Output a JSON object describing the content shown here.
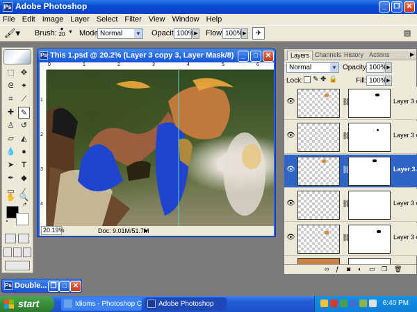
{
  "window": {
    "title": "Adobe Photoshop"
  },
  "menu": [
    "File",
    "Edit",
    "Image",
    "Layer",
    "Select",
    "Filter",
    "View",
    "Window",
    "Help"
  ],
  "options": {
    "brush_label": "Brush:",
    "brush_size": "20",
    "mode_label": "Mode:",
    "mode_value": "Normal",
    "opacity_label": "Opacity:",
    "opacity_value": "100%",
    "flow_label": "Flow:",
    "flow_value": "100%"
  },
  "document": {
    "title": "This 1.psd @ 20.2% (Layer 3 copy 3, Layer Mask/8)",
    "ruler_top": [
      "0",
      "1",
      "2",
      "3",
      "4",
      "5",
      "6"
    ],
    "ruler_left": [
      "1",
      "2",
      "3",
      "4"
    ],
    "zoom": "20.19%",
    "doc_info": "Doc: 9.01M/51.7M"
  },
  "layers_panel": {
    "tabs": [
      "Layers",
      "Channels",
      "History",
      "Actions"
    ],
    "blend_mode": "Normal",
    "opacity_label": "Opacity:",
    "opacity_value": "100%",
    "lock_label": "Lock:",
    "fill_label": "Fill:",
    "fill_value": "100%",
    "layers": [
      {
        "name": "Layer 3 c...",
        "selected": false
      },
      {
        "name": "Layer 3 c...",
        "selected": false
      },
      {
        "name": "Layer 3...",
        "selected": true
      },
      {
        "name": "Layer 3 c...",
        "selected": false
      },
      {
        "name": "Layer 3 c...",
        "selected": false
      }
    ]
  },
  "minimized_window": {
    "title": "Double..."
  },
  "taskbar": {
    "start": "start",
    "buttons": [
      "Idioms - Photoshop C...",
      "Adobe Photoshop"
    ],
    "clock": "6:40 PM"
  },
  "colors": {
    "xp_blue": "#0a4fd4",
    "selection_blue": "#3165c5",
    "start_green": "#3c8f3a",
    "foreground_color": "#000000",
    "background_color": "#ffffff"
  }
}
